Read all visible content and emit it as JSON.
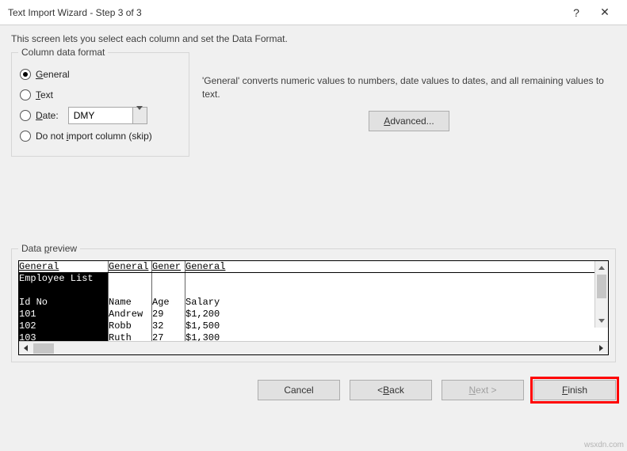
{
  "titlebar": {
    "title": "Text Import Wizard - Step 3 of 3",
    "help": "?",
    "close": "✕"
  },
  "intro": "This screen lets you select each column and set the Data Format.",
  "format": {
    "legend": "Column data format",
    "general": "General",
    "text": "Text",
    "date": "Date:",
    "skip": "Do not import column (skip)",
    "date_value": "DMY"
  },
  "desc": "'General' converts numeric values to numbers, date values to dates, and all remaining values to text.",
  "advanced_btn": "Advanced...",
  "preview": {
    "legend": "Data preview",
    "headers": [
      "General",
      "General",
      "Gener",
      "General"
    ],
    "col0": [
      "Employee List",
      "",
      "Id No",
      "101",
      "102",
      "103"
    ],
    "col1": [
      "",
      "",
      "Name",
      "Andrew",
      "Robb",
      "Ruth"
    ],
    "col2": [
      "",
      "",
      "Age",
      "29",
      "32",
      "27"
    ],
    "col3": [
      "",
      "",
      "Salary",
      "$1,200",
      "$1,500",
      "$1,300"
    ]
  },
  "buttons": {
    "cancel": "Cancel",
    "back": "< Back",
    "next": "Next >",
    "finish": "Finish"
  },
  "watermark": "wsxdn.com"
}
